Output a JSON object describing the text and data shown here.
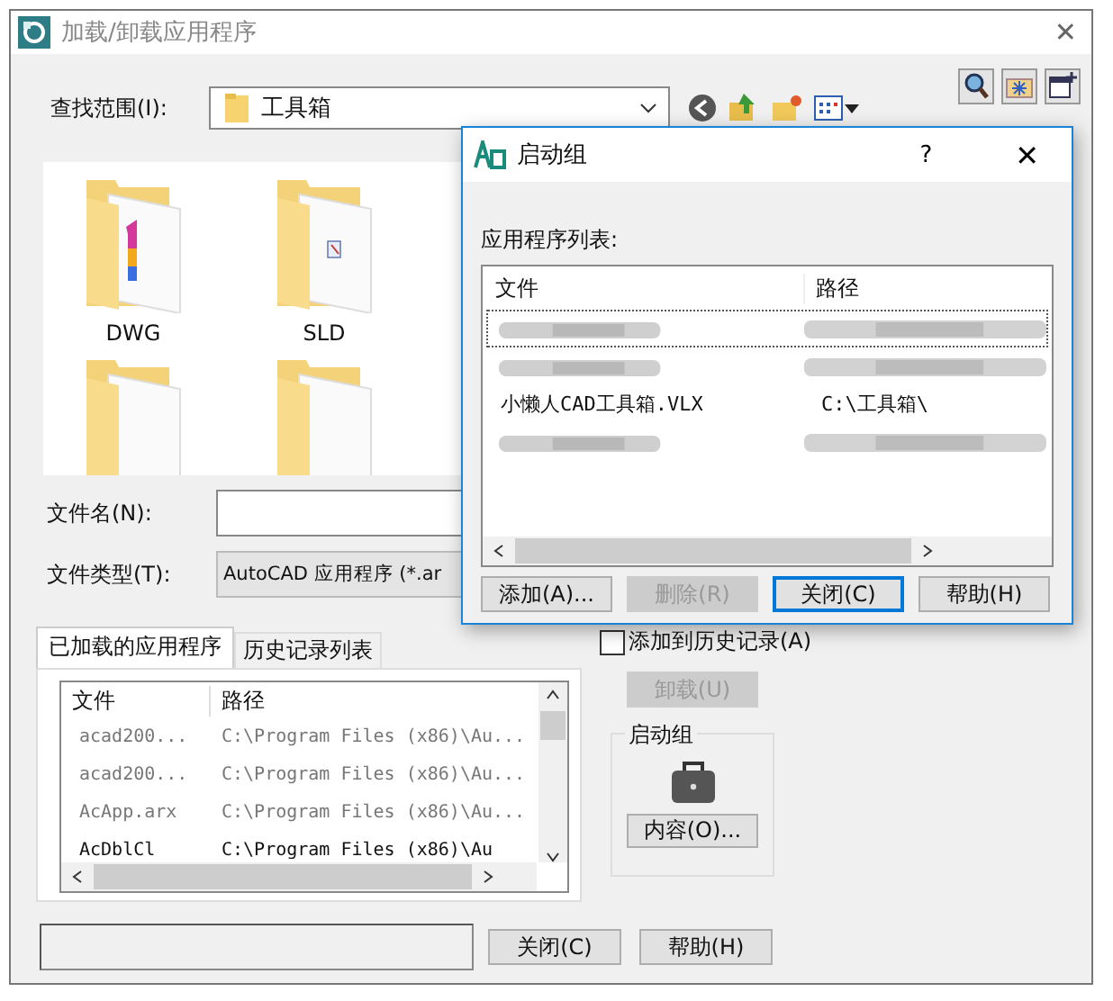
{
  "window": {
    "title": "加载/卸载应用程序",
    "close": "✕"
  },
  "look_in": {
    "label": "查找范围(I):",
    "value": "工具箱"
  },
  "folders": [
    {
      "kind": "digit-folder",
      "label": "DWG"
    },
    {
      "kind": "doc-folder",
      "label": "SLD"
    },
    {
      "kind": "folder"
    },
    {
      "kind": "folder"
    }
  ],
  "file_name": {
    "label": "文件名(N):"
  },
  "file_type": {
    "label": "文件类型(T):",
    "value": "AutoCAD 应用程序 (*.ar"
  },
  "tabs": [
    {
      "label": "已加载的应用程序",
      "selected": true
    },
    {
      "label": "历史记录列表",
      "selected": false
    }
  ],
  "loaded_list": {
    "columns": [
      "文件",
      "路径"
    ],
    "rows": [
      {
        "file": "acad200...",
        "path": "C:\\Program Files (x86)\\Au...",
        "dimmed": true
      },
      {
        "file": "acad200...",
        "path": "C:\\Program Files (x86)\\Au...",
        "dimmed": true
      },
      {
        "file": "AcApp.arx",
        "path": "C:\\Program Files (x86)\\Au...",
        "dimmed": true
      },
      {
        "file": "AcDblCl",
        "path": "C:\\Program Files (x86)\\Au",
        "dimmed": false
      }
    ]
  },
  "add_to_history": {
    "label": "添加到历史记录(A)",
    "checked": false
  },
  "unload_button": {
    "label": "卸载(U)",
    "disabled": true
  },
  "startup_group": {
    "title": "启动组",
    "button": "内容(O)..."
  },
  "buttons": [
    {
      "label": "关闭(C)"
    },
    {
      "label": "帮助(H)"
    }
  ],
  "startup_dialog": {
    "title": "启动组",
    "help": "?",
    "close": "✕",
    "list_label": "应用程序列表:",
    "columns": [
      "文件",
      "路径"
    ],
    "rows": [
      {
        "kind": "blurred",
        "focused": true
      },
      {
        "kind": "blurred",
        "focused": false
      },
      {
        "kind": "text",
        "file": "小懒人CAD工具箱.VLX",
        "path": "C:\\工具箱\\",
        "focused": false
      },
      {
        "kind": "blurred",
        "focused": false
      }
    ],
    "buttons": [
      {
        "label": "添加(A)...",
        "disabled": false,
        "default": false
      },
      {
        "label": "删除(R)",
        "disabled": true,
        "default": false
      },
      {
        "label": "关闭(C)",
        "disabled": false,
        "default": true
      },
      {
        "label": "帮助(H)",
        "disabled": false,
        "default": false
      }
    ]
  }
}
